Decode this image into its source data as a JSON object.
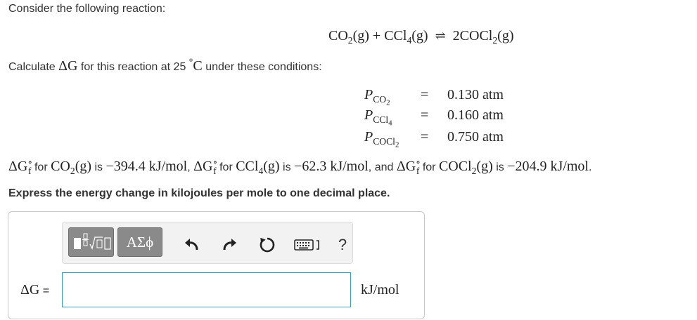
{
  "intro": "Consider the following reaction:",
  "equation": {
    "left_a": "CO",
    "left_a_sub": "2",
    "phase_a": "(g)",
    "plus": "+",
    "left_b": "CCl",
    "left_b_sub": "4",
    "phase_b": "(g)",
    "arrow": "⇌",
    "right": "2COCl",
    "right_sub": "2",
    "phase_c": "(g)"
  },
  "calc": {
    "prefix": "Calculate",
    "symbol": "ΔG",
    "middle": "for this reaction at 25",
    "degree": "°",
    "unit": "C",
    "suffix": "under these conditions:"
  },
  "conditions": [
    {
      "p": "P",
      "species": "CO",
      "sub": "2",
      "eq": "=",
      "value": "0.130 atm"
    },
    {
      "p": "P",
      "species": "CCl",
      "sub": "4",
      "eq": "=",
      "value": "0.160 atm"
    },
    {
      "p": "P",
      "species": "COCl",
      "sub": "2",
      "eq": "=",
      "value": "0.750 atm"
    }
  ],
  "formation": {
    "dg": "ΔG",
    "sup": "∘",
    "sub": "f",
    "for_word": "for",
    "is_word": "is",
    "and_word": ", and",
    "sep": ",",
    "end": ".",
    "items": [
      {
        "species": "CO",
        "s_sub": "2",
        "phase": "(g)",
        "value": "−394.4 kJ/mol"
      },
      {
        "species": "CCl",
        "s_sub": "4",
        "phase": "(g)",
        "value": "−62.3 kJ/mol"
      },
      {
        "species": "COCl",
        "s_sub": "2",
        "phase": "(g)",
        "value": "−204.9 kJ/mol"
      }
    ]
  },
  "instruction": "Express the energy change in kilojoules per mole to one decimal place.",
  "toolbar": {
    "greek_label": "ΑΣϕ",
    "help_label": "?",
    "icons": [
      "templates-icon",
      "undo-icon",
      "redo-icon",
      "reset-icon",
      "keyboard-icon"
    ]
  },
  "answer": {
    "label": "ΔG",
    "equals": "=",
    "value": "",
    "placeholder": "",
    "unit": "kJ/mol"
  },
  "colors": {
    "input_border": "#3b9bbd",
    "toolbar_button": "#8a8a8a"
  }
}
